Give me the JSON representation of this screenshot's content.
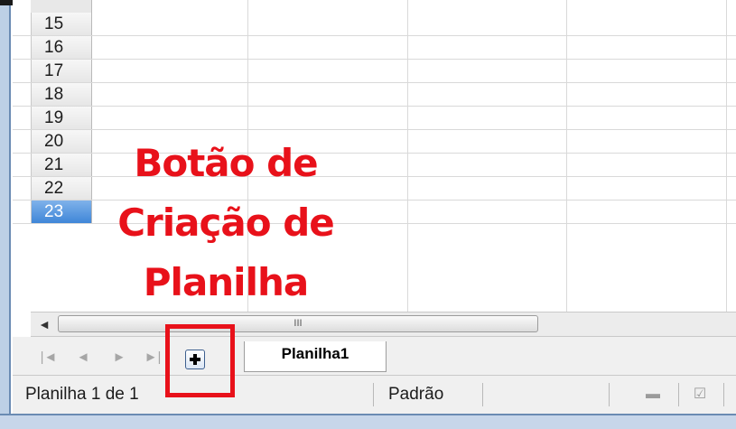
{
  "rows": [
    "15",
    "16",
    "17",
    "18",
    "19",
    "20",
    "21",
    "22",
    "23"
  ],
  "selected_row": "23",
  "annotation": {
    "lines": [
      "Botão de",
      "Criação de",
      "Planilha"
    ],
    "color": "#e8111a"
  },
  "scrollbar": {
    "left_arrow": "◄",
    "thumb_grip": "III"
  },
  "sheet_nav": {
    "first": "|◄",
    "prev": "◄",
    "next": "►",
    "last": "►|"
  },
  "add_sheet_icon": "plus-icon",
  "sheet_tab": "Planilha1",
  "status": {
    "sheet_position": "Planilha 1 de 1",
    "page_style": "Padrão"
  }
}
